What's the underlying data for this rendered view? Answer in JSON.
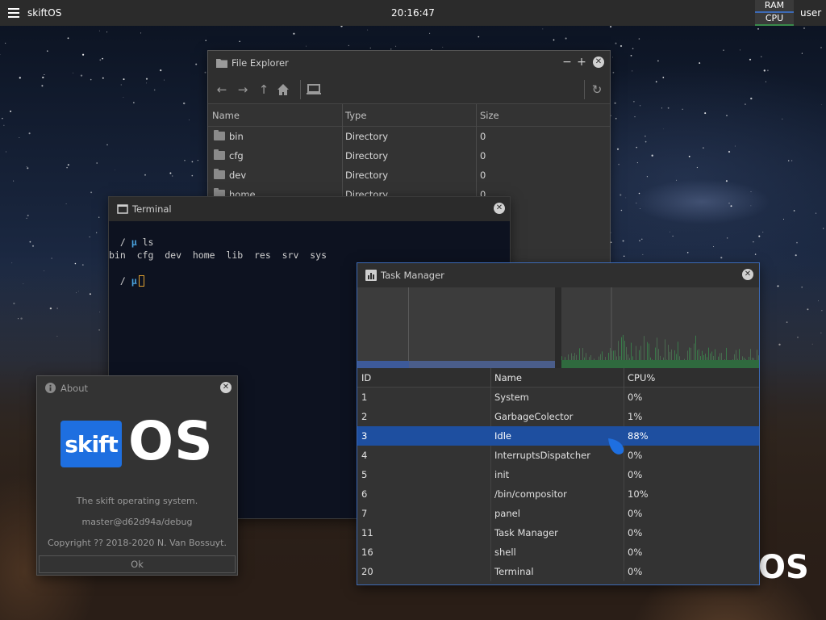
{
  "panel": {
    "title": "skiftOS",
    "clock": "20:16:47",
    "meters": {
      "ram_label": "RAM",
      "cpu_label": "CPU"
    },
    "user": "user"
  },
  "file_explorer": {
    "title": "File Explorer",
    "columns": [
      "Name",
      "Type",
      "Size"
    ],
    "rows": [
      {
        "name": "bin",
        "type": "Directory",
        "size": "0"
      },
      {
        "name": "cfg",
        "type": "Directory",
        "size": "0"
      },
      {
        "name": "dev",
        "type": "Directory",
        "size": "0"
      },
      {
        "name": "home",
        "type": "Directory",
        "size": "0"
      }
    ]
  },
  "terminal": {
    "title": "Terminal",
    "prompt_dir": "/",
    "prompt_symbol": "µ",
    "command": "ls",
    "output": "bin  cfg  dev  home  lib  res  srv  sys"
  },
  "task_manager": {
    "title": "Task Manager",
    "columns": {
      "id": "ID",
      "name": "Name",
      "cpu": "CPU%"
    },
    "ram_usage_fraction": 0.26,
    "rows": [
      {
        "id": "1",
        "name": "System",
        "cpu": "0%"
      },
      {
        "id": "2",
        "name": "GarbageColector",
        "cpu": "1%"
      },
      {
        "id": "3",
        "name": "Idle",
        "cpu": "88%"
      },
      {
        "id": "4",
        "name": "InterruptsDispatcher",
        "cpu": "0%"
      },
      {
        "id": "5",
        "name": "init",
        "cpu": "0%"
      },
      {
        "id": "6",
        "name": "/bin/compositor",
        "cpu": "10%"
      },
      {
        "id": "7",
        "name": "panel",
        "cpu": "0%"
      },
      {
        "id": "11",
        "name": "Task Manager",
        "cpu": "0%"
      },
      {
        "id": "16",
        "name": "shell",
        "cpu": "0%"
      },
      {
        "id": "20",
        "name": "Terminal",
        "cpu": "0%"
      }
    ],
    "selected_index": 2
  },
  "about": {
    "title": "About",
    "logo_box": "skift",
    "logo_text": "OS",
    "description": "The skift operating system.",
    "version": "master@d62d94a/debug",
    "copyright": "Copyright ?? 2018-2020 N. Van Bossuyt.",
    "ok_label": "Ok"
  },
  "wallpaper": {
    "text": "OS"
  },
  "colors": {
    "accent": "#1e4fa0",
    "panel": "#2b2b2b",
    "ram": "#3d6ab5",
    "cpu": "#3a8a4a"
  }
}
